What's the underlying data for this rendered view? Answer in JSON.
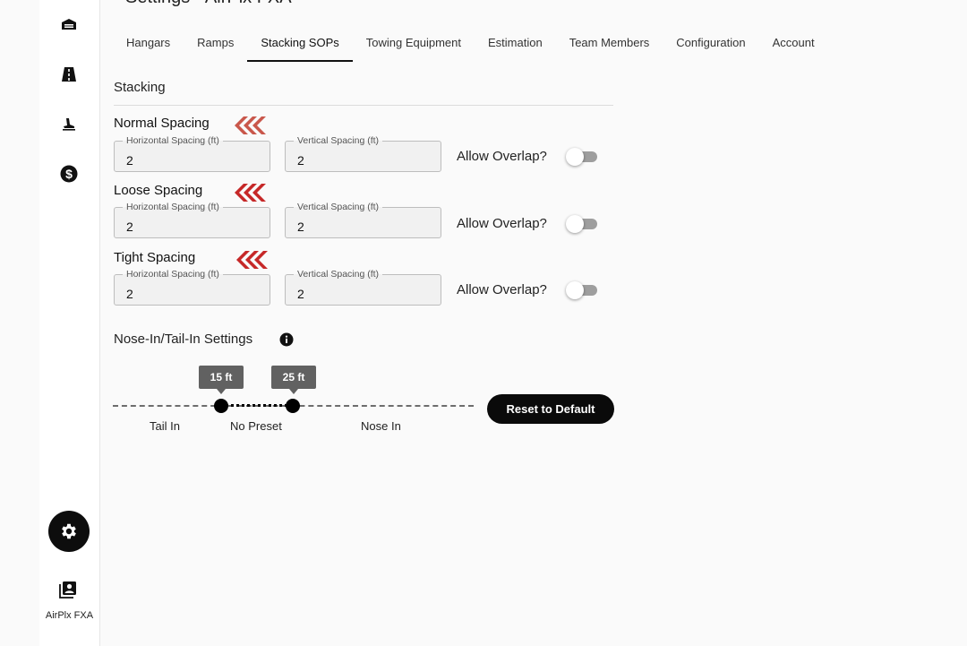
{
  "page": {
    "title": "Settings - AirPlx FXA"
  },
  "sidebar": {
    "items": [
      {
        "icon": "hangar-icon"
      },
      {
        "icon": "ramp-icon"
      },
      {
        "icon": "tow-icon"
      },
      {
        "icon": "dollar-icon"
      }
    ],
    "settings_icon": "gear-icon",
    "org": {
      "icon": "account-box-icon",
      "label": "AirPlx FXA"
    }
  },
  "tabs": [
    {
      "label": "Hangars"
    },
    {
      "label": "Ramps"
    },
    {
      "label": "Stacking SOPs",
      "active": true
    },
    {
      "label": "Towing Equipment"
    },
    {
      "label": "Estimation"
    },
    {
      "label": "Team Members"
    },
    {
      "label": "Configuration"
    },
    {
      "label": "Account"
    }
  ],
  "stacking": {
    "title": "Stacking",
    "horizontal_label": "Horizontal Spacing (ft)",
    "vertical_label": "Vertical Spacing (ft)",
    "overlap_label": "Allow Overlap?",
    "presets": [
      {
        "title": "Normal Spacing",
        "horizontal": "2",
        "vertical": "2",
        "allow_overlap": false
      },
      {
        "title": "Loose Spacing",
        "horizontal": "2",
        "vertical": "2",
        "allow_overlap": false
      },
      {
        "title": "Tight Spacing",
        "horizontal": "2",
        "vertical": "2",
        "allow_overlap": false
      }
    ],
    "accent_color": "#c62828"
  },
  "nose_in": {
    "title": "Nose-In/Tail-In Settings",
    "min_value": "15 ft",
    "max_value": "25 ft",
    "labels": [
      "Tail In",
      "No Preset",
      "Nose In"
    ],
    "reset_label": "Reset to Default"
  }
}
